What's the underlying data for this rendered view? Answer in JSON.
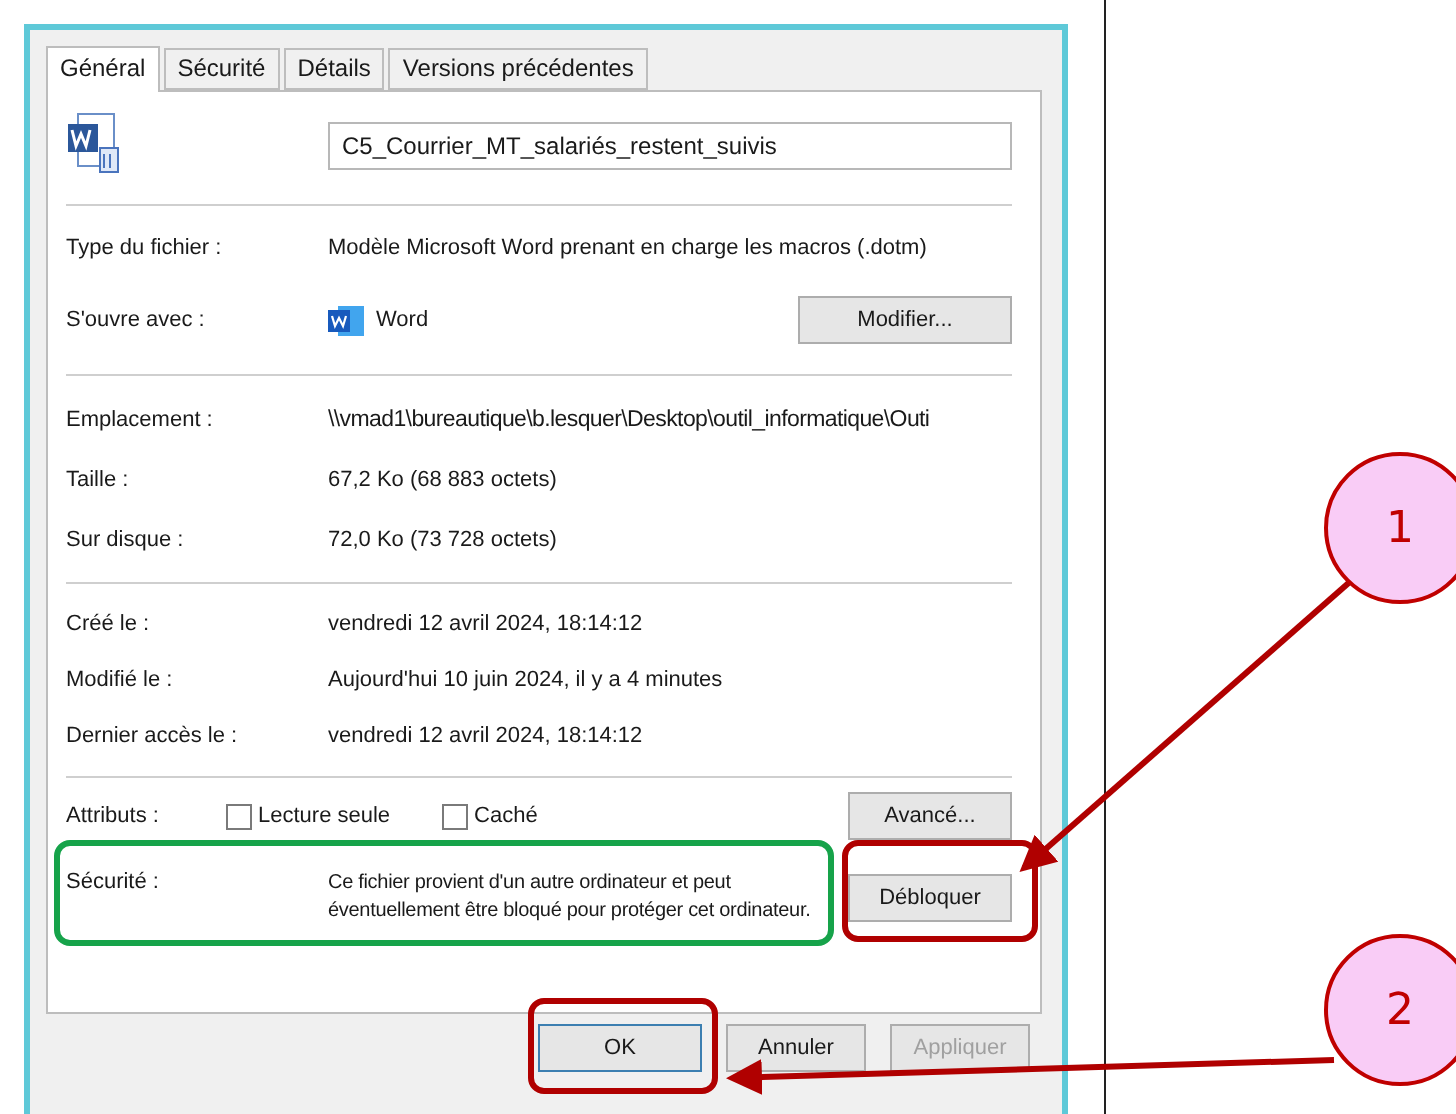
{
  "tabs": [
    {
      "label": "Général",
      "selected": true
    },
    {
      "label": "Sécurité",
      "selected": false
    },
    {
      "label": "Détails",
      "selected": false
    },
    {
      "label": "Versions précédentes",
      "selected": false
    }
  ],
  "file_name": "C5_Courrier_MT_salariés_restent_suivis",
  "type_row": {
    "label": "Type du fichier :",
    "value": "Modèle Microsoft Word prenant en charge les macros (.dotm)"
  },
  "opens_with": {
    "label": "S'ouvre avec :",
    "app": "Word",
    "button": "Modifier..."
  },
  "location_rows": [
    {
      "label": "Emplacement :",
      "value": "\\\\vmad1\\bureautique\\b.lesquer\\Desktop\\outil_informatique\\Outi"
    },
    {
      "label": "Taille :",
      "value": "67,2 Ko (68 883 octets)"
    },
    {
      "label": "Sur disque :",
      "value": "72,0 Ko (73 728 octets)"
    }
  ],
  "date_rows": [
    {
      "label": "Créé le :",
      "value": "vendredi 12 avril 2024, 18:14:12"
    },
    {
      "label": "Modifié le :",
      "value": "Aujourd'hui 10 juin 2024, il y a 4 minutes"
    },
    {
      "label": "Dernier accès le :",
      "value": "vendredi 12 avril 2024, 18:14:12"
    }
  ],
  "attributes": {
    "label": "Attributs :",
    "checkboxes": [
      {
        "label": "Lecture seule",
        "checked": false
      },
      {
        "label": "Caché",
        "checked": false
      }
    ],
    "button": "Avancé..."
  },
  "security": {
    "label": "Sécurité :",
    "text": "Ce fichier provient d'un autre ordinateur et peut éventuellement être bloqué pour protéger cet ordinateur.",
    "button": "Débloquer"
  },
  "buttons": [
    {
      "label": "OK",
      "disabled": false
    },
    {
      "label": "Annuler",
      "disabled": false
    },
    {
      "label": "Appliquer",
      "disabled": true
    }
  ],
  "callouts": [
    "1",
    "2"
  ]
}
